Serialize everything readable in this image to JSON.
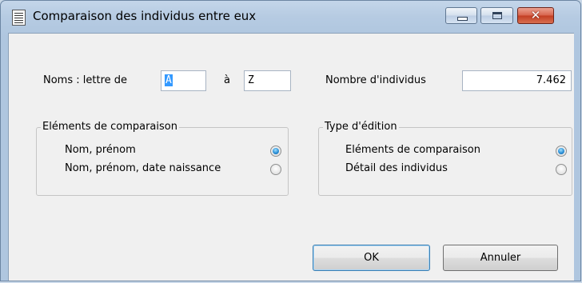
{
  "window": {
    "title": "Comparaison des individus entre eux",
    "close_glyph": "✕"
  },
  "names": {
    "label": "Noms : lettre de",
    "from_value": "A",
    "to_label": "à",
    "to_value": "Z"
  },
  "count": {
    "label": "Nombre d'individus",
    "value": "7.462"
  },
  "comparison_group": {
    "title": "Eléments de comparaison",
    "options": [
      {
        "label": "Nom, prénom",
        "checked": true
      },
      {
        "label": "Nom, prénom, date naissance",
        "checked": false
      }
    ]
  },
  "edition_group": {
    "title": "Type d'édition",
    "options": [
      {
        "label": "Eléments de comparaison",
        "checked": true
      },
      {
        "label": "Détail des individus",
        "checked": false
      }
    ]
  },
  "buttons": {
    "ok": "OK",
    "cancel": "Annuler"
  },
  "colors": {
    "title_bar": "#b6cbe2",
    "client_bg": "#f0f0f0",
    "selection": "#3399ff",
    "close_button": "#c23d22"
  },
  "icons": [
    "app-document-icon",
    "minimize-icon",
    "maximize-icon",
    "close-icon"
  ]
}
